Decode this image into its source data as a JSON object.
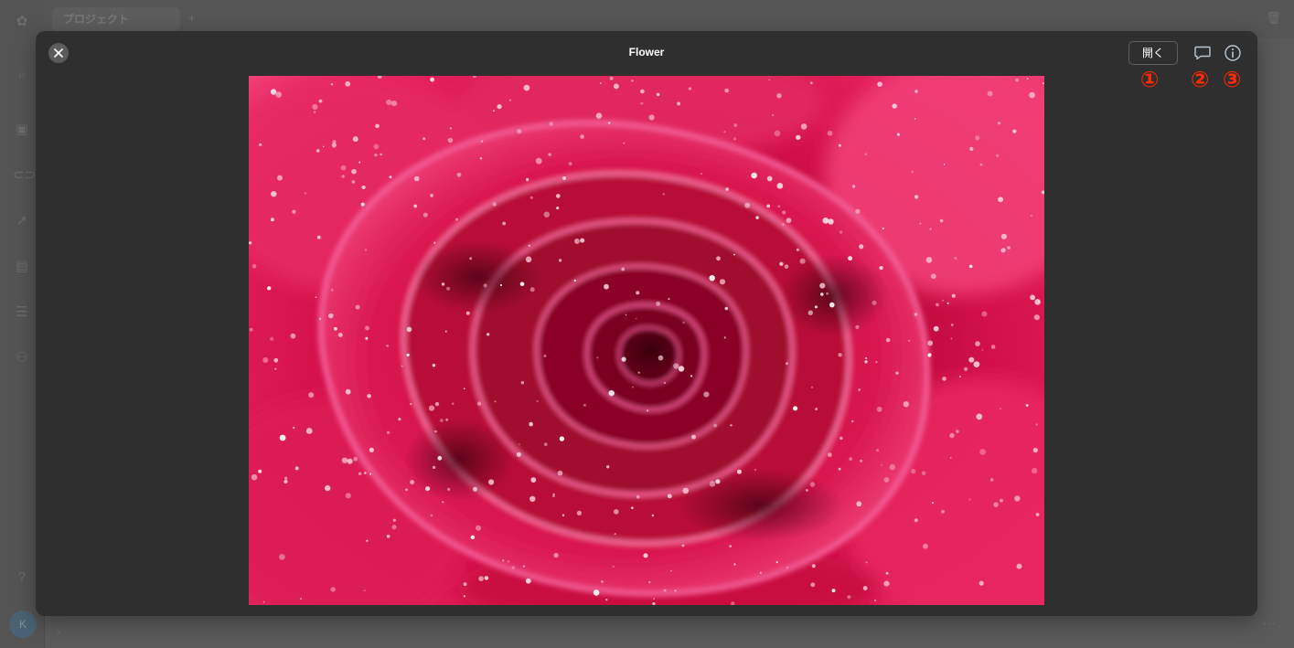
{
  "background": {
    "project_tab_label": "プロジェクト",
    "tab_add_label": "+",
    "avatar_initial": "K"
  },
  "modal": {
    "title": "Flower",
    "open_button_label": "開く",
    "close_icon": "close-icon",
    "comment_icon": "comment-icon",
    "info_icon": "info-icon"
  },
  "annotations": {
    "one": "①",
    "two": "②",
    "three": "③",
    "color": "#ff2a00"
  },
  "image": {
    "subject": "rose-photo",
    "dominant_color": "#d4104a"
  }
}
